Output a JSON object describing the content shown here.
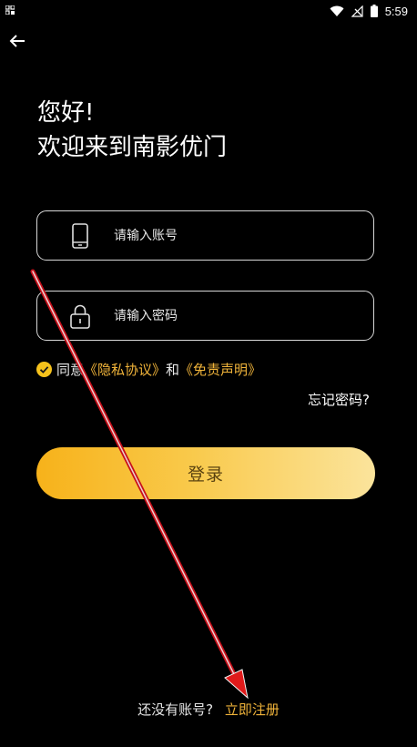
{
  "status_bar": {
    "time": "5:59",
    "icons": [
      "grid-icon",
      "wifi-icon",
      "no-signal-icon",
      "battery-icon"
    ]
  },
  "header": {
    "back_icon": "arrow-left-icon"
  },
  "greeting": {
    "line1": "您好!",
    "line2": "欢迎来到南影优门"
  },
  "form": {
    "account": {
      "icon": "phone-icon",
      "placeholder": "请输入账号",
      "value": ""
    },
    "password": {
      "icon": "lock-icon",
      "placeholder": "请输入密码",
      "value": ""
    },
    "agreement": {
      "checked": true,
      "prefix": "同意",
      "privacy_link": "《隐私协议》",
      "conjunction": "和",
      "disclaimer_link": "《免责声明》"
    },
    "forgot_password": "忘记密码?",
    "login_button": "登录"
  },
  "footer": {
    "prompt": "还没有账号?",
    "register_link": "立即注册"
  },
  "colors": {
    "background": "#000000",
    "accent": "#f1b43a",
    "button_gradient_start": "#f7b21a",
    "button_gradient_end": "#fbe49c",
    "annotation_arrow": "#e01a1a"
  }
}
